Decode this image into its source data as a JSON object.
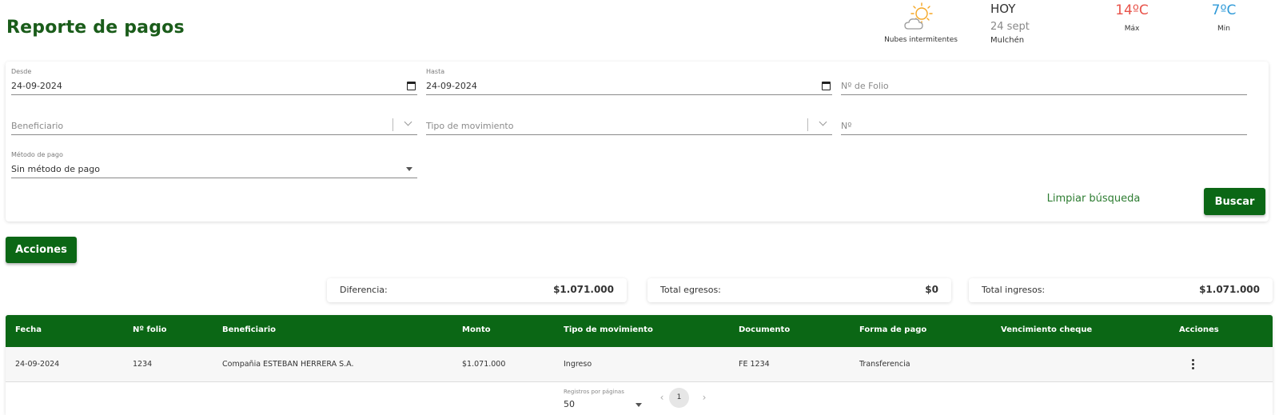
{
  "page": {
    "title": "Reporte de pagos"
  },
  "weather": {
    "description": "Nubes intermitentes",
    "day": "HOY",
    "date": "24 sept",
    "city": "Mulchén",
    "max_temp": "14ºC",
    "max_label": "Máx",
    "min_temp": "7ºC",
    "min_label": "Min",
    "icon": "partly-cloudy-icon",
    "max_color": "#e8534a",
    "min_color": "#2f9ad8"
  },
  "filters": {
    "desde": {
      "label": "Desde",
      "value": "24-09-2024"
    },
    "hasta": {
      "label": "Hasta",
      "value": "24-09-2024"
    },
    "folio": {
      "placeholder": "Nº de Folio"
    },
    "beneficiario": {
      "placeholder": "Beneficiario"
    },
    "tipo_movimiento": {
      "placeholder": "Tipo de movimiento"
    },
    "numero": {
      "placeholder": "Nº"
    },
    "metodo_pago": {
      "label": "Método de pago",
      "value": "Sin método de pago"
    }
  },
  "buttons": {
    "clear": "Limpiar búsqueda",
    "search": "Buscar",
    "actions": "Acciones"
  },
  "summary": {
    "diferencia": {
      "label": "Diferencia:",
      "value": "$1.071.000"
    },
    "egresos": {
      "label": "Total egresos:",
      "value": "$0"
    },
    "ingresos": {
      "label": "Total ingresos:",
      "value": "$1.071.000"
    }
  },
  "table": {
    "columns": [
      "Fecha",
      "Nº folio",
      "Beneficiario",
      "Monto",
      "Tipo de movimiento",
      "Documento",
      "Forma de pago",
      "Vencimiento cheque",
      "Acciones"
    ],
    "rows": [
      [
        "24-09-2024",
        "1234",
        "Compañia ESTEBAN HERRERA S.A.",
        "$1.071.000",
        "Ingreso",
        "FE 1234",
        "Transferencia",
        ""
      ]
    ]
  },
  "pagination": {
    "rows_label": "Registros por páginas",
    "rows_value": "50",
    "current_page": "1"
  },
  "colors": {
    "primary": "#0b6715",
    "title": "#1a5c1a"
  }
}
